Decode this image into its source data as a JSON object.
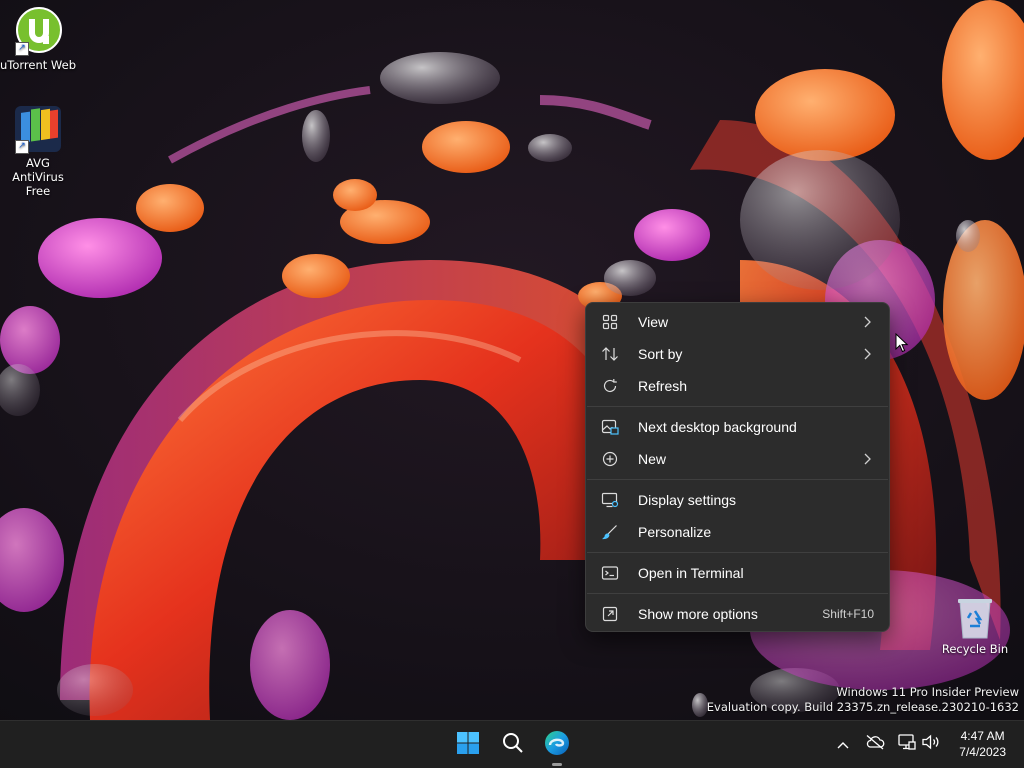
{
  "desktop": {
    "icons": [
      {
        "label": "uTorrent Web",
        "icon": "utorrent-icon"
      },
      {
        "label": "AVG AntiVirus Free",
        "icon": "avg-antivirus-icon"
      },
      {
        "label": "Recycle Bin",
        "icon": "recycle-bin-icon"
      }
    ],
    "watermark": {
      "line1": "Windows 11 Pro Insider Preview",
      "line2": "Evaluation copy. Build 23375.zn_release.230210-1632"
    }
  },
  "context_menu": {
    "items": [
      {
        "label": "View",
        "icon": "grid-view-icon",
        "submenu": true
      },
      {
        "label": "Sort by",
        "icon": "sort-icon",
        "submenu": true
      },
      {
        "label": "Refresh",
        "icon": "refresh-icon",
        "submenu": false
      },
      {
        "label": "Next desktop background",
        "icon": "next-background-icon",
        "submenu": false
      },
      {
        "label": "New",
        "icon": "new-plus-icon",
        "submenu": true
      },
      {
        "label": "Display settings",
        "icon": "display-settings-icon",
        "submenu": false
      },
      {
        "label": "Personalize",
        "icon": "brush-icon",
        "submenu": false
      },
      {
        "label": "Open in Terminal",
        "icon": "terminal-icon",
        "submenu": false
      },
      {
        "label": "Show more options",
        "icon": "show-more-options-icon",
        "submenu": false,
        "shortcut": "Shift+F10"
      }
    ]
  },
  "taskbar": {
    "pinned": [
      {
        "name": "Start",
        "icon": "windows-start-icon"
      },
      {
        "name": "Search",
        "icon": "search-icon"
      },
      {
        "name": "Microsoft Edge",
        "icon": "edge-icon"
      }
    ],
    "tray": [
      "chevron-up-icon",
      "cloud-offline-icon",
      "network-icon",
      "volume-icon"
    ],
    "clock": {
      "time": "4:47 AM",
      "date": "7/4/2023"
    }
  },
  "colors": {
    "menu_bg": "#2c2c2c",
    "taskbar_bg": "#202020",
    "accent_blue": "#4cc2ff",
    "utorrent_green": "#78c02e"
  }
}
